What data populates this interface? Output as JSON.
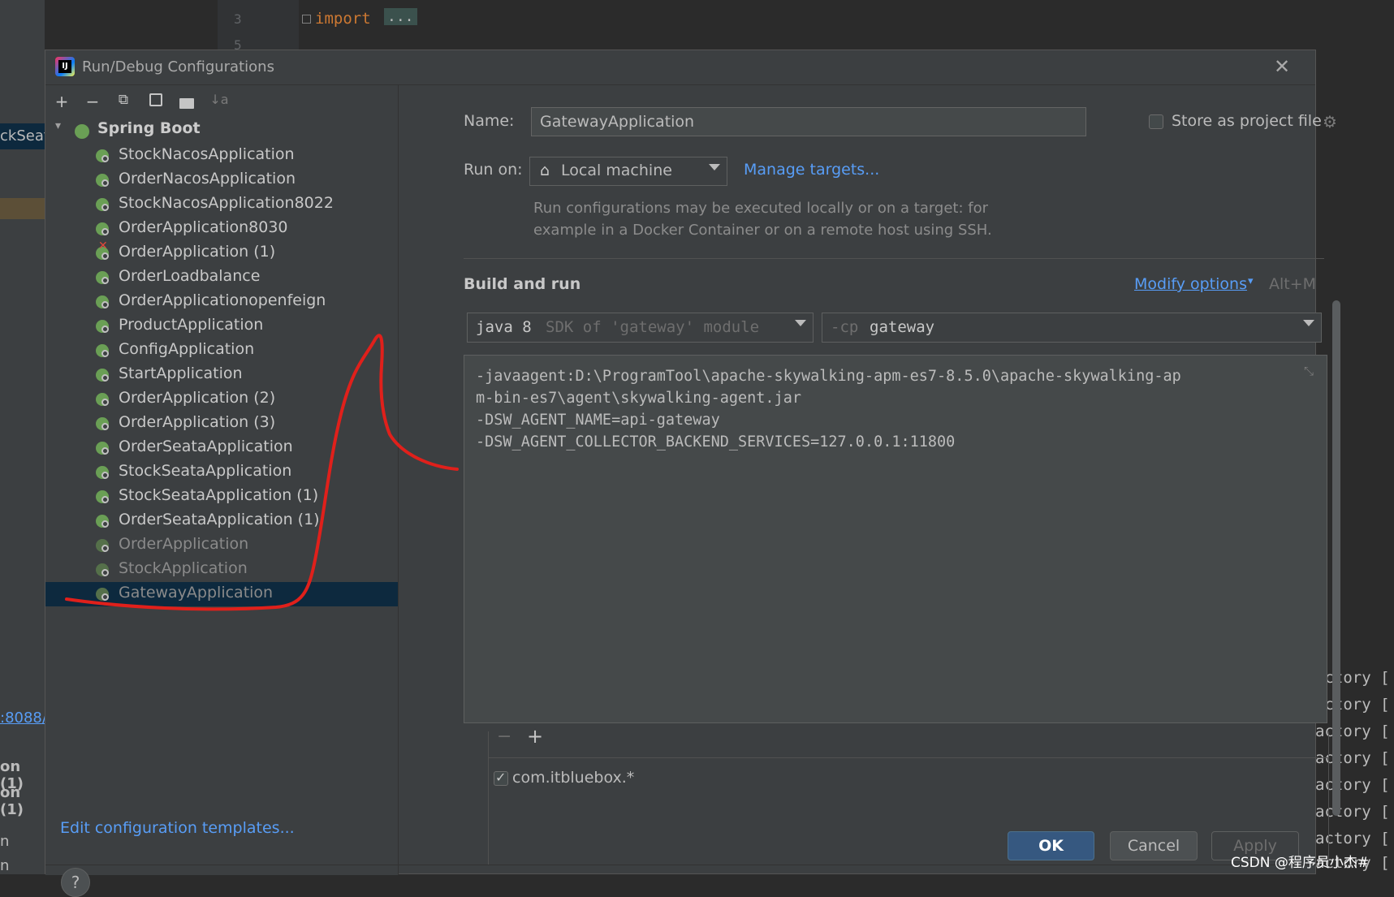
{
  "ide": {
    "line_numbers": [
      "3",
      "5"
    ],
    "code_keyword": "import",
    "code_fold": "...",
    "left_fragments": [
      "ckSeat",
      ":8088/",
      "on (1)",
      "on (1)",
      "n",
      "n"
    ],
    "log_lines": [
      "actory [",
      "actory [",
      "actory [",
      "actory [",
      "actory [",
      "actory [",
      "actory [",
      "actory ["
    ]
  },
  "dialog": {
    "title": "Run/Debug Configurations",
    "toolbar": {
      "add": "+",
      "remove": "−",
      "copy": "⧉",
      "save": "💾",
      "move_to_folder": "📁",
      "sort": "↓a"
    },
    "tree": {
      "root_label": "Spring Boot",
      "items": [
        {
          "label": "StockNacosApplication"
        },
        {
          "label": "OrderNacosApplication"
        },
        {
          "label": "StockNacosApplication8022"
        },
        {
          "label": "OrderApplication8030"
        },
        {
          "label": "OrderApplication (1)"
        },
        {
          "label": "OrderLoadbalance"
        },
        {
          "label": "OrderApplicationopenfeign"
        },
        {
          "label": "ProductApplication"
        },
        {
          "label": "ConfigApplication"
        },
        {
          "label": "StartApplication"
        },
        {
          "label": "OrderApplication (2)"
        },
        {
          "label": "OrderApplication (3)"
        },
        {
          "label": "OrderSeataApplication"
        },
        {
          "label": "StockSeataApplication"
        },
        {
          "label": "StockSeataApplication (1)"
        },
        {
          "label": "OrderSeataApplication (1)"
        },
        {
          "label": "OrderApplication"
        },
        {
          "label": "StockApplication"
        },
        {
          "label": "GatewayApplication"
        }
      ]
    },
    "edit_templates_link": "Edit configuration templates...",
    "help": "?",
    "form": {
      "name_label": "Name:",
      "name_value": "GatewayApplication",
      "store_label": "Store as project file",
      "run_on_label": "Run on:",
      "run_on_value": "Local machine",
      "manage_targets": "Manage targets...",
      "hint_line1": "Run configurations may be executed locally or on a target: for",
      "hint_line2": "example in a Docker Container or on a remote host using SSH.",
      "build_and_run": "Build and run",
      "modify_options": "Modify options",
      "modify_shortcut": "Alt+M",
      "sdk_main": "java 8",
      "sdk_hint": "SDK of 'gateway' module",
      "cp_prefix": "-cp",
      "cp_value": "gateway",
      "vm_options": "-javaagent:D:\\ProgramTool\\apache-skywalking-apm-es7-8.5.0\\apache-skywalking-ap\nm-bin-es7\\agent\\skywalking-agent.jar\n-DSW_AGENT_NAME=api-gateway\n-DSW_AGENT_COLLECTOR_BACKEND_SERVICES=127.0.0.1:11800",
      "list_remove": "−",
      "list_add": "+",
      "package_entry": "com.itbluebox.*"
    },
    "buttons": {
      "ok": "OK",
      "cancel": "Cancel",
      "apply": "Apply"
    }
  },
  "watermark": "CSDN @程序员小杰#",
  "annotation_color": "#e0201b"
}
